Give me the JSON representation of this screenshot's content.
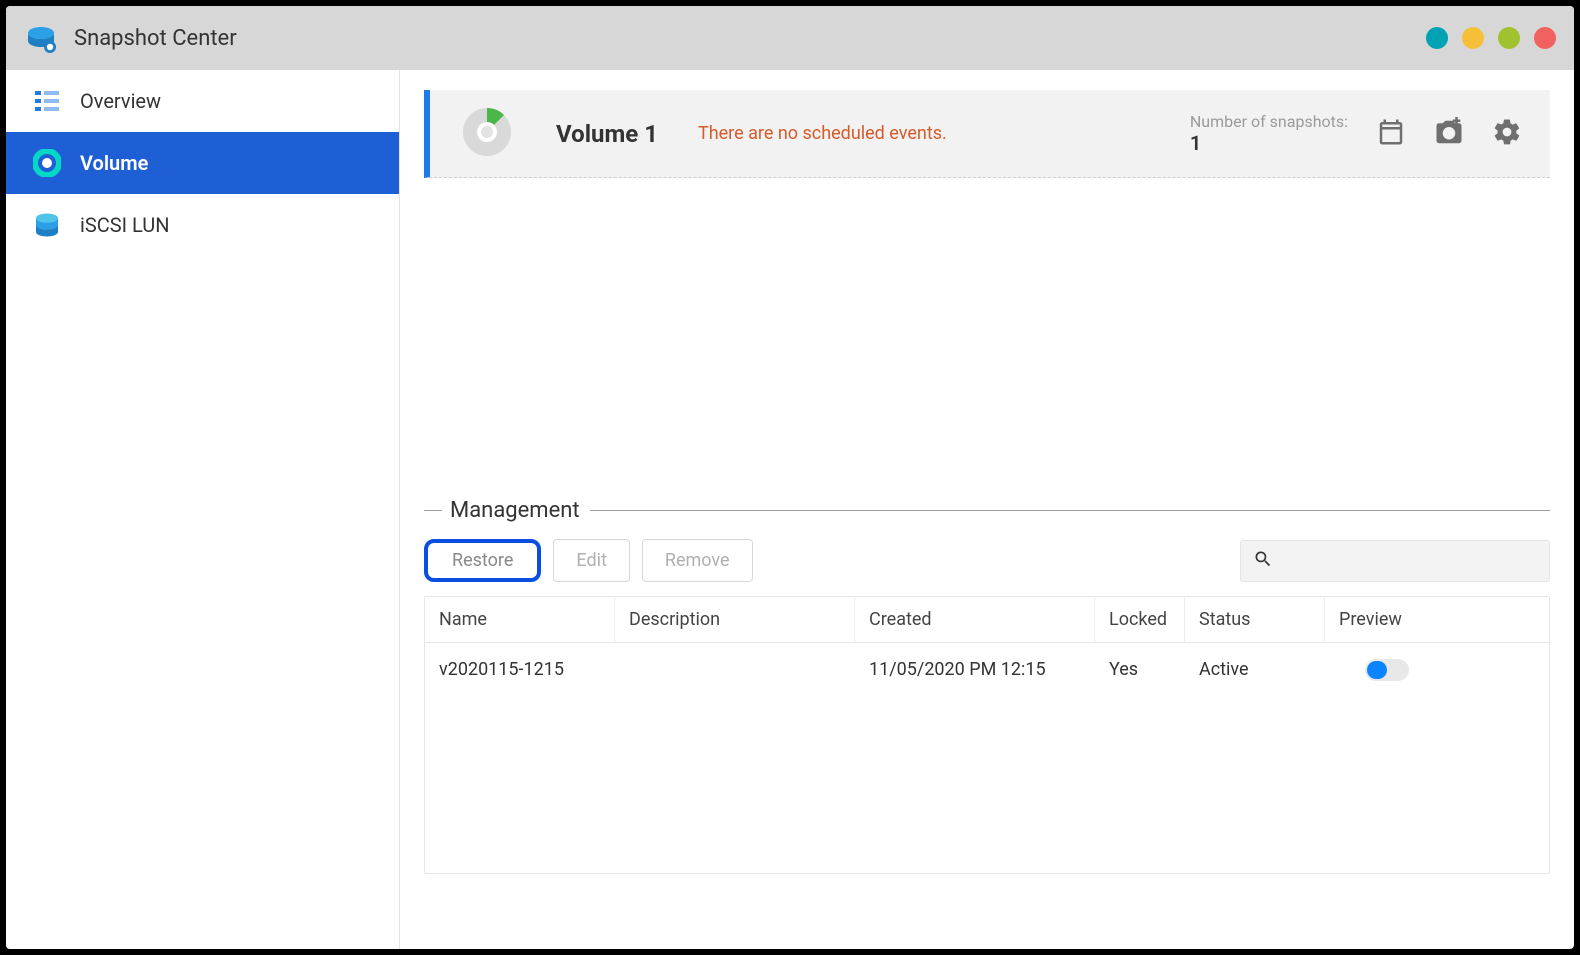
{
  "window": {
    "title": "Snapshot Center"
  },
  "sidebar": {
    "items": [
      {
        "label": "Overview"
      },
      {
        "label": "Volume"
      },
      {
        "label": "iSCSI LUN"
      }
    ]
  },
  "volume_panel": {
    "name": "Volume 1",
    "message": "There are no scheduled events.",
    "snap_label": "Number of snapshots:",
    "snap_count": "1"
  },
  "management": {
    "title": "Management",
    "buttons": {
      "restore": "Restore",
      "edit": "Edit",
      "remove": "Remove"
    },
    "search_placeholder": "",
    "columns": {
      "name": "Name",
      "description": "Description",
      "created": "Created",
      "locked": "Locked",
      "status": "Status",
      "preview": "Preview"
    },
    "rows": [
      {
        "name": "v2020115-1215",
        "description": "",
        "created": "11/05/2020 PM 12:15",
        "locked": "Yes",
        "status": "Active",
        "preview": true
      }
    ]
  }
}
